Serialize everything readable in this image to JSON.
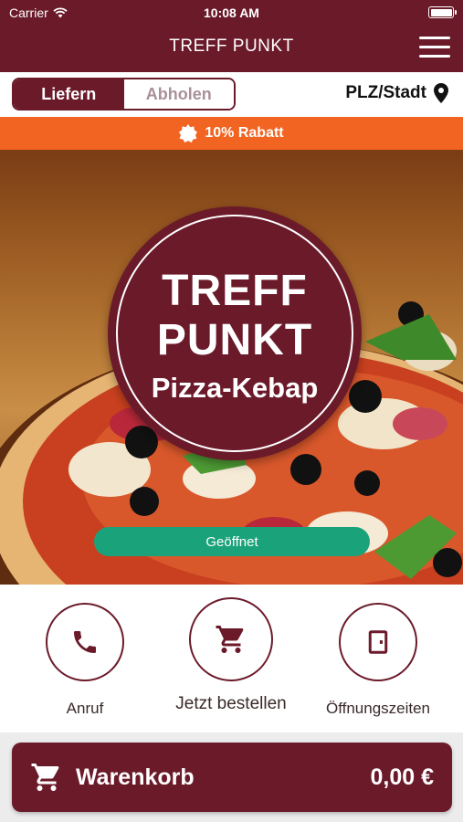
{
  "status_bar": {
    "carrier": "Carrier",
    "time": "10:08 AM"
  },
  "header": {
    "title": "TREFF PUNKT"
  },
  "mode": {
    "deliver_label": "Liefern",
    "pickup_label": "Abholen",
    "location_label": "PLZ/Stadt",
    "selected": "Liefern"
  },
  "promo": {
    "text": "10% Rabatt"
  },
  "logo": {
    "line1": "TREFF",
    "line2": "PUNKT",
    "line3": "Pizza-Kebap"
  },
  "status": {
    "open_label": "Geöffnet"
  },
  "actions": [
    {
      "label": "Anruf",
      "icon": "phone-icon"
    },
    {
      "label": "Jetzt bestellen",
      "icon": "cart-icon"
    },
    {
      "label": "Öffnungszeiten",
      "icon": "door-icon"
    }
  ],
  "cart": {
    "label": "Warenkorb",
    "total": "0,00 €"
  },
  "colors": {
    "brand": "#6b1a2a",
    "promo": "#f26422",
    "open": "#1aa37a"
  }
}
